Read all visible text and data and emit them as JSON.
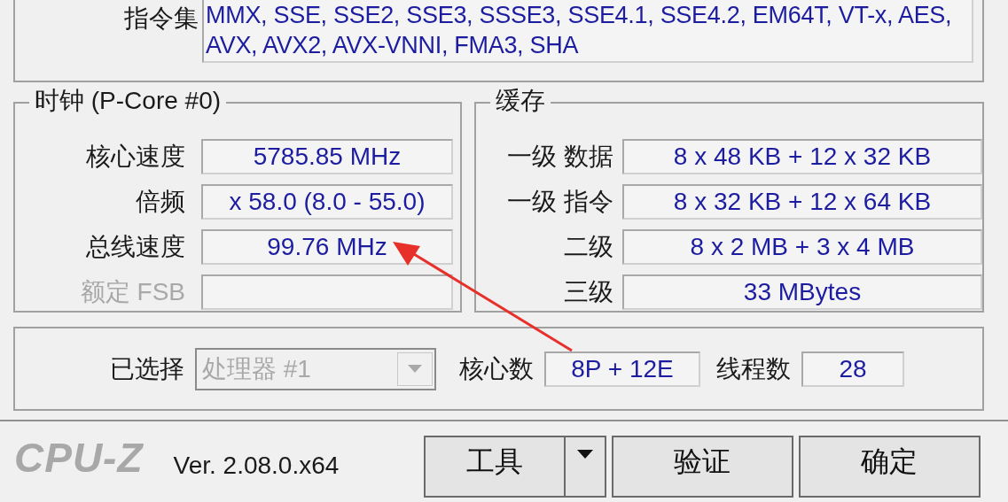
{
  "instructions": {
    "label": "指令集",
    "value": "MMX, SSE, SSE2, SSE3, SSSE3, SSE4.1, SSE4.2, EM64T, VT-x, AES, AVX, AVX2, AVX-VNNI, FMA3, SHA"
  },
  "clocks": {
    "title": "时钟 (P-Core #0)",
    "rows": [
      {
        "label": "核心速度",
        "value": "5785.85 MHz",
        "disabled": false
      },
      {
        "label": "倍频",
        "value": "x 58.0 (8.0 - 55.0)",
        "disabled": false
      },
      {
        "label": "总线速度",
        "value": "99.76 MHz",
        "disabled": false
      },
      {
        "label": "额定 FSB",
        "disabled": true
      }
    ]
  },
  "cache": {
    "title": "缓存",
    "rows": [
      {
        "label": "一级 数据",
        "value": "8 x 48 KB + 12 x 32 KB"
      },
      {
        "label": "一级 指令",
        "value": "8 x 32 KB + 12 x 64 KB"
      },
      {
        "label": "二级",
        "value": "8 x 2 MB + 3 x 4 MB"
      },
      {
        "label": "三级",
        "value": "33 MBytes"
      }
    ]
  },
  "selection": {
    "label": "已选择",
    "dropdown": {
      "value": "处理器 #1",
      "disabled": true
    },
    "cores_label": "核心数",
    "cores": "8P + 12E",
    "threads_label": "线程数",
    "threads": "28"
  },
  "footer": {
    "logo": "CPU-Z",
    "version": "Ver. 2.08.0.x64",
    "buttons": [
      {
        "label": "工具",
        "kind": "dropdown"
      },
      {
        "label": "验证",
        "kind": "plain"
      },
      {
        "label": "确定",
        "kind": "plain"
      }
    ]
  },
  "annotation": {
    "kind": "arrow",
    "color": "#e8302a"
  }
}
